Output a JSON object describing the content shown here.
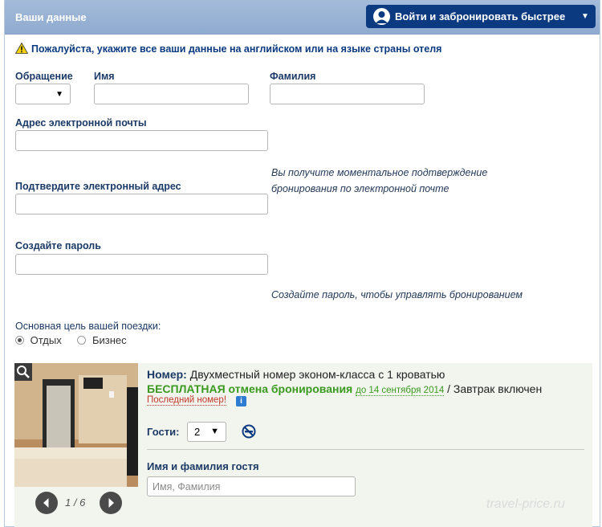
{
  "header": {
    "title": "Ваши данные",
    "login_button": "Войти и забронировать быстрее"
  },
  "warning": "Пожалуйста, укажите все ваши данные на английском или на языке страны отеля",
  "form": {
    "salutation_label": "Обращение",
    "salutation_value": "",
    "first_name_label": "Имя",
    "first_name_value": "",
    "last_name_label": "Фамилия",
    "last_name_value": "",
    "email_label": "Адрес электронной почты",
    "email_value": "",
    "confirm_email_label": "Подтвердите электронный адрес",
    "confirm_email_value": "",
    "email_hint_line1": "Вы получите моментальное подтверждение",
    "email_hint_line2": "бронирования по электронной почте",
    "password_label": "Создайте пароль",
    "password_value": "",
    "password_hint": "Создайте пароль, чтобы управлять бронированием",
    "trip_purpose_label": "Основная цель вашей поездки:",
    "trip_options": [
      {
        "label": "Отдых",
        "selected": true
      },
      {
        "label": "Бизнес",
        "selected": false
      }
    ]
  },
  "room": {
    "room_label": "Номер:",
    "room_name": "Двухместный номер эконом-класса с 1 кроватью",
    "free_cancel": "БЕСПЛАТНАЯ отмена бронирования",
    "cancel_until": "до 14 сентября 2014",
    "breakfast": "/ Завтрак включен",
    "last_room": "Последний номер!",
    "info_icon": "i",
    "guests_label": "Гости:",
    "guests_value": "2",
    "guest_name_label": "Имя и фамилия гостя",
    "guest_name_placeholder": "Имя, Фамилия",
    "photo_counter": "1 / 6"
  },
  "watermark": "travel-price.ru",
  "icons": [
    "user-avatar-icon",
    "caret-down-icon",
    "warning-icon",
    "zoom-icon",
    "prev-arrow-icon",
    "next-arrow-icon",
    "no-smoking-icon",
    "info-icon"
  ],
  "colors": {
    "header_blue": "#8fabd0",
    "button_navy": "#0b3a80",
    "green": "#3a9a1f",
    "red": "#c0392b"
  }
}
